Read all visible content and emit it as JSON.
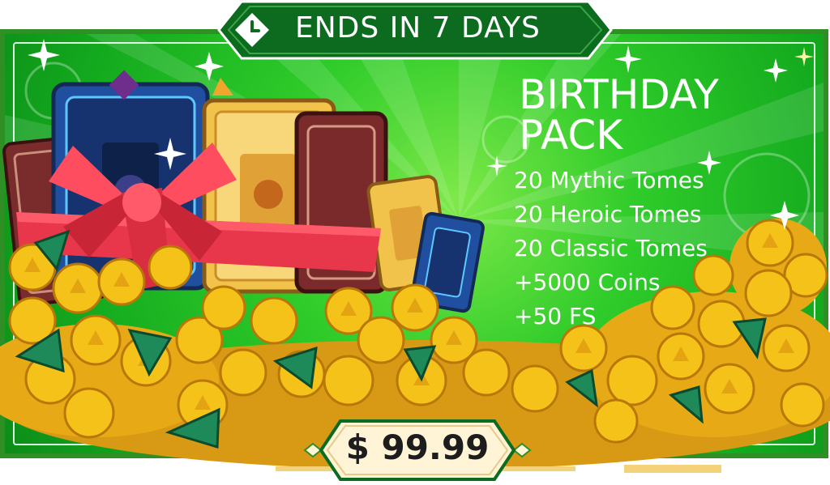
{
  "timer": {
    "label": "ENDS IN 7 DAYS",
    "icon": "clock-icon"
  },
  "pack": {
    "title_line1": "BIRTHDAY",
    "title_line2": "PACK",
    "items": [
      "20 Mythic Tomes",
      "20 Heroic Tomes",
      "20 Classic Tomes",
      "+5000 Coins",
      "+50 FS"
    ]
  },
  "price": {
    "label": "$ 99.99"
  },
  "colors": {
    "background_green": "#13a91e",
    "banner_green": "#0d6b20",
    "price_cream": "#fff4d6",
    "coin_gold": "#f5c21a",
    "ribbon_red": "#e8364a"
  }
}
